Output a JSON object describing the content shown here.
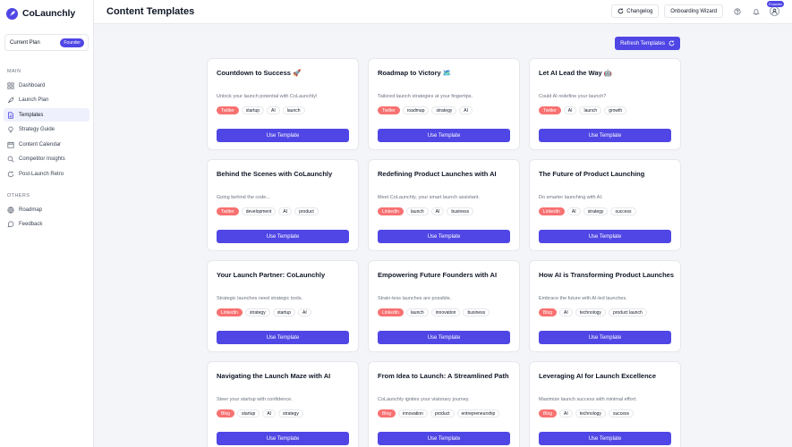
{
  "brand": {
    "name": "CoLaunchly"
  },
  "plan": {
    "label": "Current Plan",
    "badge": "Founder"
  },
  "sidebar": {
    "main_label": "MAIN",
    "main_items": [
      {
        "label": "Dashboard",
        "icon": "grid-icon"
      },
      {
        "label": "Launch Plan",
        "icon": "rocket-icon"
      },
      {
        "label": "Templates",
        "icon": "document-icon",
        "active": true
      },
      {
        "label": "Strategy Guide",
        "icon": "lightbulb-icon"
      },
      {
        "label": "Content Calendar",
        "icon": "calendar-icon"
      },
      {
        "label": "Competitor Insights",
        "icon": "search-icon"
      },
      {
        "label": "Post-Launch Retro",
        "icon": "refresh-icon"
      }
    ],
    "others_label": "OTHERS",
    "other_items": [
      {
        "label": "Roadmap",
        "icon": "map-icon"
      },
      {
        "label": "Feedback",
        "icon": "chat-icon"
      }
    ]
  },
  "header": {
    "title": "Content Templates",
    "changelog_label": "Changelog",
    "onboarding_label": "Onboarding Wizard",
    "founder_tag": "Founder"
  },
  "toolbar": {
    "refresh_label": "Refresh Templates"
  },
  "use_template_label": "Use Template",
  "cards": [
    {
      "title": "Countdown to Success 🚀",
      "desc": "Unlock your launch potential with CoLaunchly!",
      "tags": [
        "Twitter",
        "startup",
        "AI",
        "launch"
      ]
    },
    {
      "title": "Roadmap to Victory 🗺️",
      "desc": "Tailored launch strategies at your fingertips.",
      "tags": [
        "Twitter",
        "roadmap",
        "strategy",
        "AI"
      ]
    },
    {
      "title": "Let AI Lead the Way 🤖",
      "desc": "Could AI redefine your launch?",
      "tags": [
        "Twitter",
        "AI",
        "launch",
        "growth"
      ]
    },
    {
      "title": "Behind the Scenes with CoLaunchly",
      "desc": "Going behind the code...",
      "tags": [
        "Twitter",
        "development",
        "AI",
        "product"
      ]
    },
    {
      "title": "Redefining Product Launches with AI",
      "desc": "Meet CoLaunchly, your smart launch assistant.",
      "tags": [
        "LinkedIn",
        "launch",
        "AI",
        "business"
      ]
    },
    {
      "title": "The Future of Product Launching",
      "desc": "Do smarter launching with AI.",
      "tags": [
        "LinkedIn",
        "AI",
        "strategy",
        "success"
      ]
    },
    {
      "title": "Your Launch Partner: CoLaunchly",
      "desc": "Strategic launches need strategic tools.",
      "tags": [
        "LinkedIn",
        "strategy",
        "startup",
        "AI"
      ]
    },
    {
      "title": "Empowering Future Founders with AI",
      "desc": "Strain-less launches are possible.",
      "tags": [
        "LinkedIn",
        "launch",
        "innovation",
        "business"
      ]
    },
    {
      "title": "How AI is Transforming Product Launches",
      "desc": "Embrace the future with AI-led launches.",
      "tags": [
        "Blog",
        "AI",
        "technology",
        "product launch"
      ]
    },
    {
      "title": "Navigating the Launch Maze with AI",
      "desc": "Steer your startup with confidence.",
      "tags": [
        "Blog",
        "startup",
        "AI",
        "strategy"
      ]
    },
    {
      "title": "From Idea to Launch: A Streamlined Path",
      "desc": "CoLaunchly ignites your visionary journey.",
      "tags": [
        "Blog",
        "innovation",
        "product",
        "entrepreneurship"
      ]
    },
    {
      "title": "Leveraging AI for Launch Excellence",
      "desc": "Maximize launch success with minimal effort.",
      "tags": [
        "Blog",
        "AI",
        "technology",
        "success"
      ]
    }
  ],
  "colors": {
    "accent": "#4f46e5",
    "platform_tag": "#f87171",
    "active_nav": "#eef0fd"
  }
}
